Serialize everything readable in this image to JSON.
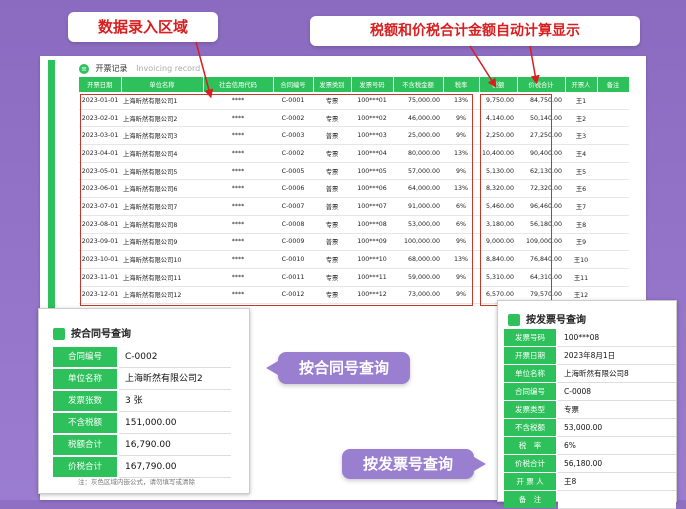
{
  "callouts": {
    "entry_area": "数据录入区域",
    "auto_calc": "税额和价税合计金额自动计算显示"
  },
  "sheet": {
    "title": "开票记录",
    "title_en": "Invoicing record"
  },
  "table": {
    "headers": [
      "开票日期",
      "单位名称",
      "社会信用代码",
      "合同编号",
      "发票类别",
      "发票号码",
      "不含税金额",
      "税率",
      "税额",
      "价税合计",
      "开票人",
      "备注"
    ],
    "rows": [
      [
        "2023-01-01",
        "上海昕然有限公司1",
        "****",
        "C-0001",
        "专票",
        "100***01",
        "75,000.00",
        "13%",
        "9,750.00",
        "84,750.00",
        "王1",
        ""
      ],
      [
        "2023-02-01",
        "上海昕然有限公司2",
        "****",
        "C-0002",
        "专票",
        "100***02",
        "46,000.00",
        "9%",
        "4,140.00",
        "50,140.00",
        "王2",
        ""
      ],
      [
        "2023-03-01",
        "上海昕然有限公司3",
        "****",
        "C-0003",
        "普票",
        "100***03",
        "25,000.00",
        "9%",
        "2,250.00",
        "27,250.00",
        "王3",
        ""
      ],
      [
        "2023-04-01",
        "上海昕然有限公司4",
        "****",
        "C-0002",
        "专票",
        "100***04",
        "80,000.00",
        "13%",
        "10,400.00",
        "90,400.00",
        "王4",
        ""
      ],
      [
        "2023-05-01",
        "上海昕然有限公司5",
        "****",
        "C-0005",
        "专票",
        "100***05",
        "57,000.00",
        "9%",
        "5,130.00",
        "62,130.00",
        "王5",
        ""
      ],
      [
        "2023-06-01",
        "上海昕然有限公司6",
        "****",
        "C-0006",
        "普票",
        "100***06",
        "64,000.00",
        "13%",
        "8,320.00",
        "72,320.00",
        "王6",
        ""
      ],
      [
        "2023-07-01",
        "上海昕然有限公司7",
        "****",
        "C-0007",
        "普票",
        "100***07",
        "91,000.00",
        "6%",
        "5,460.00",
        "96,460.00",
        "王7",
        ""
      ],
      [
        "2023-08-01",
        "上海昕然有限公司8",
        "****",
        "C-0008",
        "专票",
        "100***08",
        "53,000.00",
        "6%",
        "3,180.00",
        "56,180.00",
        "王8",
        ""
      ],
      [
        "2023-09-01",
        "上海昕然有限公司9",
        "****",
        "C-0009",
        "普票",
        "100***09",
        "100,000.00",
        "9%",
        "9,000.00",
        "109,000.00",
        "王9",
        ""
      ],
      [
        "2023-10-01",
        "上海昕然有限公司10",
        "****",
        "C-0010",
        "专票",
        "100***10",
        "68,000.00",
        "13%",
        "8,840.00",
        "76,840.00",
        "王10",
        ""
      ],
      [
        "2023-11-01",
        "上海昕然有限公司11",
        "****",
        "C-0011",
        "专票",
        "100***11",
        "59,000.00",
        "9%",
        "5,310.00",
        "64,310.00",
        "王11",
        ""
      ],
      [
        "2023-12-01",
        "上海昕然有限公司12",
        "****",
        "C-0012",
        "专票",
        "100***12",
        "73,000.00",
        "9%",
        "6,570.00",
        "79,570.00",
        "王12",
        ""
      ]
    ]
  },
  "contract_query": {
    "title": "按合同号查询",
    "fields": [
      {
        "label": "合同编号",
        "value": "C-0002"
      },
      {
        "label": "单位名称",
        "value": "上海昕然有限公司2"
      },
      {
        "label": "发票张数",
        "value": "3 张"
      },
      {
        "label": "不含税额",
        "value": "151,000.00"
      },
      {
        "label": "税额合计",
        "value": "16,790.00"
      },
      {
        "label": "价税合计",
        "value": "167,790.00"
      }
    ],
    "note": "注：灰色区域内嵌公式，请勿填写或清除"
  },
  "invoice_query": {
    "title": "按发票号查询",
    "fields": [
      {
        "label": "发票号码",
        "value": "100***08"
      },
      {
        "label": "开票日期",
        "value": "2023年8月1日"
      },
      {
        "label": "单位名称",
        "value": "上海昕然有限公司8"
      },
      {
        "label": "合同编号",
        "value": "C-0008"
      },
      {
        "label": "发票类型",
        "value": "专票"
      },
      {
        "label": "不含税额",
        "value": "53,000.00"
      },
      {
        "label": "税　率",
        "value": "6%"
      },
      {
        "label": "价税合计",
        "value": "56,180.00"
      },
      {
        "label": "开 票 人",
        "value": "王8"
      },
      {
        "label": "备　注",
        "value": ""
      }
    ]
  },
  "bubbles": {
    "contract": "按合同号查询",
    "invoice": "按发票号查询"
  },
  "colors": {
    "accent_green": "#2ec15b",
    "background_purple": "#8f6fc2",
    "highlight_red": "#c0392b"
  }
}
